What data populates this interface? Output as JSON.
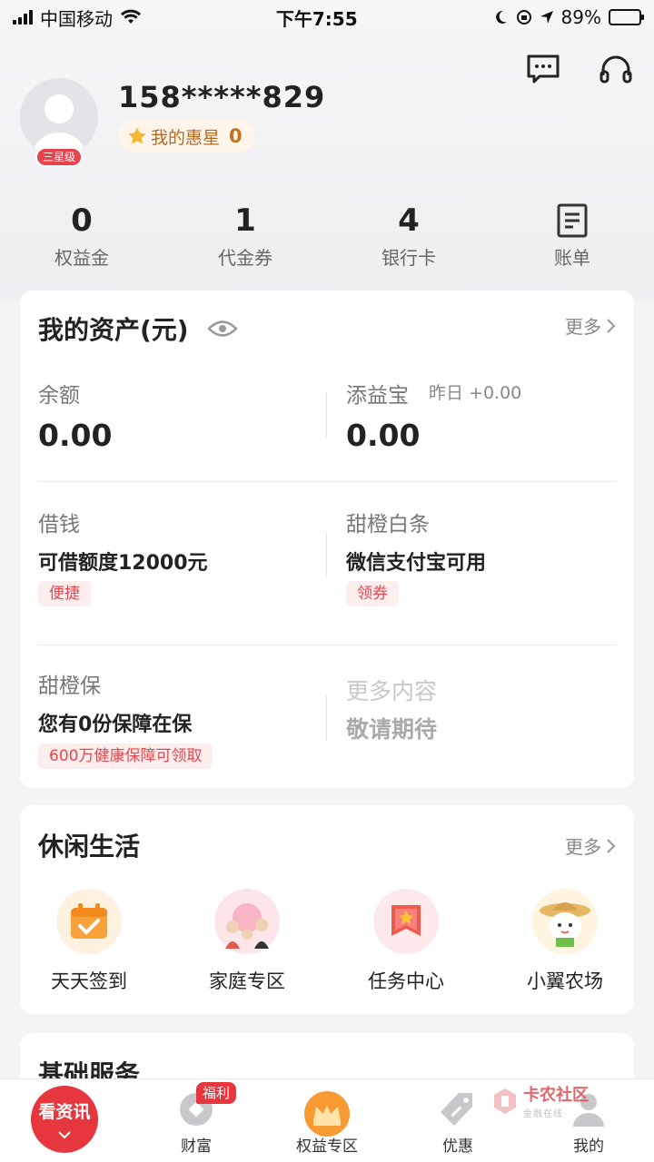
{
  "status_bar": {
    "carrier": "中国移动",
    "time": "下午7:55",
    "battery": "89%",
    "battery_level": 0.89
  },
  "profile": {
    "phone": "158*****829",
    "star_label": "我的惠星",
    "star_count": "0",
    "level": "三星级"
  },
  "stats": [
    {
      "value": "0",
      "label": "权益金"
    },
    {
      "value": "1",
      "label": "代金券"
    },
    {
      "value": "4",
      "label": "银行卡"
    },
    {
      "label": "账单",
      "icon": "bill-icon"
    }
  ],
  "assets": {
    "title": "我的资产(元)",
    "more": "更多",
    "balance_label": "余额",
    "balance_value": "0.00",
    "tianyibao_label": "添益宝",
    "tianyibao_yesterday": "昨日 +0.00",
    "tianyibao_value": "0.00",
    "borrow_label": "借钱",
    "borrow_desc": "可借额度12000元",
    "borrow_tag": "便捷",
    "baitiao_label": "甜橙白条",
    "baitiao_desc": "微信支付宝可用",
    "baitiao_tag": "领券",
    "insure_label": "甜橙保",
    "insure_desc": "您有0份保障在保",
    "insure_tag": "600万健康保障可领取",
    "more_content": "更多内容",
    "coming_soon": "敬请期待"
  },
  "leisure": {
    "title": "休闲生活",
    "more": "更多",
    "items": [
      {
        "label": "天天签到",
        "icon": "calendar-check-icon"
      },
      {
        "label": "家庭专区",
        "icon": "family-icon"
      },
      {
        "label": "任务中心",
        "icon": "task-banner-icon"
      },
      {
        "label": "小翼农场",
        "icon": "farm-character-icon"
      }
    ]
  },
  "basic": {
    "title": "基础服务"
  },
  "bottom_nav": {
    "kanzixun": "看资讯",
    "items": [
      "财富",
      "权益专区",
      "优惠",
      "我的"
    ],
    "fuli_badge": "福利"
  },
  "watermark": {
    "title": "卡农社区",
    "subtitle": "金融在线"
  },
  "colors": {
    "accent_red": "#e6373f",
    "tag_bg": "#fdeeee",
    "star_gold": "#f5b731"
  }
}
